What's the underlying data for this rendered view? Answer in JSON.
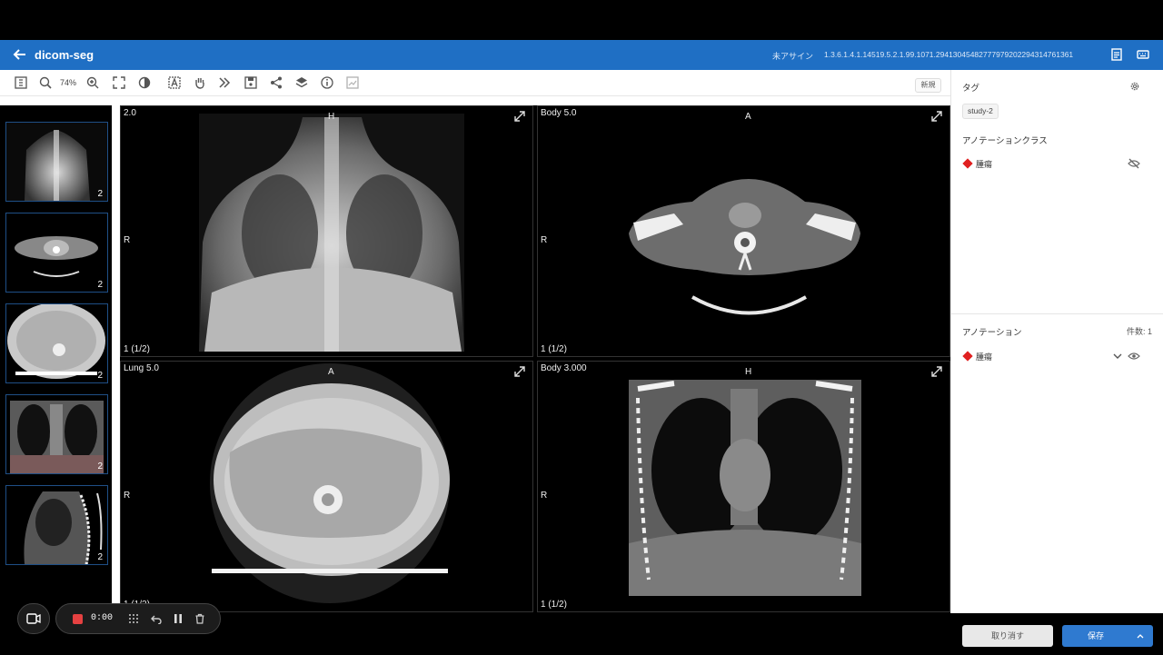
{
  "app": {
    "title": "dicom-seg",
    "assign_status": "未アサイン",
    "study_uid": "1.3.6.1.4.1.14519.5.2.1.99.1071.29413045482777979202294314761361"
  },
  "toolbar": {
    "zoom": "74%",
    "new_label": "新規"
  },
  "thumbnails": [
    {
      "count": "2",
      "kind": "xray"
    },
    {
      "count": "2",
      "kind": "axial-neck"
    },
    {
      "count": "2",
      "kind": "axial-lung"
    },
    {
      "count": "2",
      "kind": "coronal"
    },
    {
      "count": "2",
      "kind": "sagittal"
    }
  ],
  "viewports": [
    {
      "label": "2.0",
      "orient_top": "H",
      "orient_left": "R",
      "page": "1 (1/2)"
    },
    {
      "label": "Body 5.0",
      "orient_top": "A",
      "orient_left": "R",
      "page": "1 (1/2)"
    },
    {
      "label": "Lung 5.0",
      "orient_top": "A",
      "orient_left": "R",
      "page": "1 (1/2)"
    },
    {
      "label": "Body 3.000",
      "orient_top": "H",
      "orient_left": "R",
      "page": "1 (1/2)"
    }
  ],
  "panel": {
    "tag_title": "タグ",
    "tag_chip": "study-2",
    "class_title": "アノテーションクラス",
    "class_item": "腫瘍",
    "annot_title": "アノテーション",
    "annot_count": "件数: 1",
    "annot_item": "腫瘍",
    "cancel_label": "取り消す",
    "save_label": "保存"
  },
  "recorder": {
    "time": "0:00"
  },
  "colors": {
    "topbar": "#1f6fc4",
    "accent": "#2f7ad0",
    "annotation": "#e02020"
  }
}
